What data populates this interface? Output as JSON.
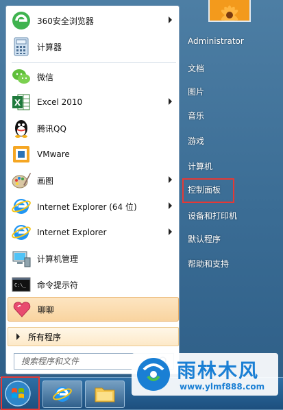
{
  "left_menu": {
    "items": [
      {
        "label": "360安全浏览器",
        "arrow": true,
        "icon": "360-browser-icon"
      },
      {
        "label": "计算器",
        "arrow": false,
        "icon": "calculator-icon"
      },
      {
        "label": "微信",
        "arrow": false,
        "icon": "wechat-icon"
      },
      {
        "label": "Excel 2010",
        "arrow": true,
        "icon": "excel-icon"
      },
      {
        "label": "腾讯QQ",
        "arrow": false,
        "icon": "qq-icon"
      },
      {
        "label": "VMware",
        "arrow": false,
        "icon": "vmware-icon"
      },
      {
        "label": "画图",
        "arrow": true,
        "icon": "paint-icon"
      },
      {
        "label": "Internet Explorer (64 位)",
        "arrow": true,
        "icon": "ie-icon"
      },
      {
        "label": "Internet Explorer",
        "arrow": true,
        "icon": "ie-icon"
      },
      {
        "label": "计算机管理",
        "arrow": false,
        "icon": "computer-management-icon"
      },
      {
        "label": "命令提示符",
        "arrow": false,
        "icon": "cmd-icon"
      },
      {
        "label": "聊聊",
        "arrow": false,
        "icon": "heart-chat-icon"
      }
    ],
    "all_programs": "所有程序",
    "search_placeholder": "搜索程序和文件"
  },
  "right_menu": {
    "items": [
      "Administrator",
      "文档",
      "图片",
      "音乐",
      "游戏",
      "计算机",
      "控制面板",
      "设备和打印机",
      "默认程序",
      "帮助和支持"
    ],
    "highlighted": "控制面板"
  },
  "watermark": {
    "title": "雨林木风",
    "url": "www.ylmf888.com"
  },
  "colors": {
    "highlight_box": "#e53935",
    "watermark_blue": "#1a7fd4"
  }
}
